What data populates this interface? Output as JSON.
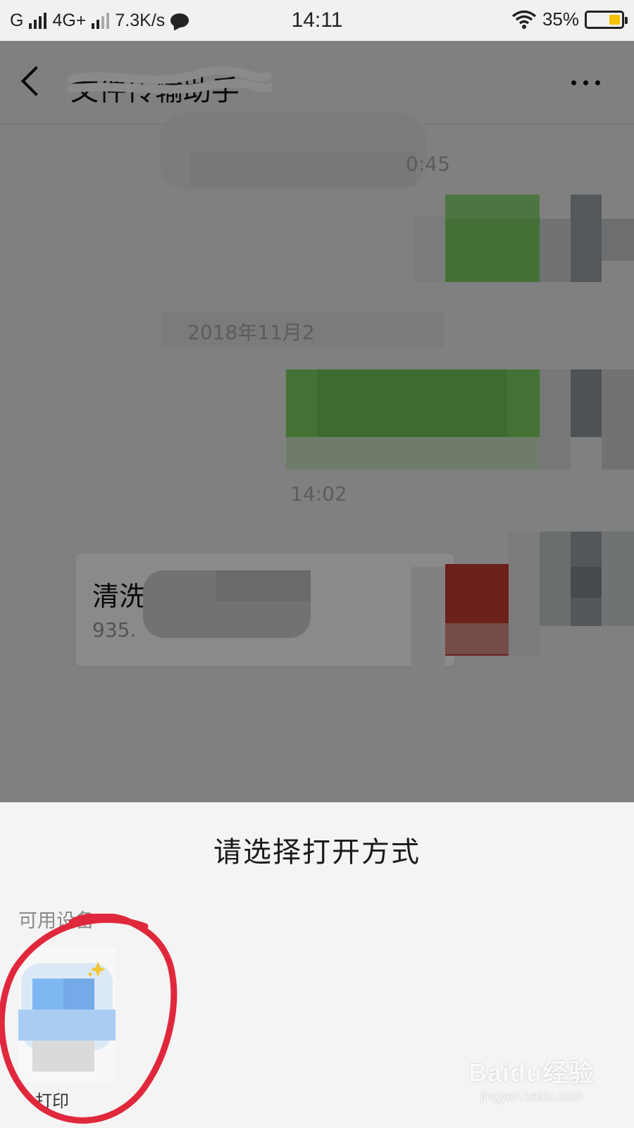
{
  "status_bar": {
    "carrier1": "G",
    "network": "4G+",
    "speed": "7.3K/s",
    "time": "14:11",
    "battery": "35%",
    "battery_level": 0.35,
    "battery_color": "#f2c200"
  },
  "chat": {
    "title": "文件传输助手",
    "timestamps": [
      "0:45",
      "2018年11月2",
      "14:02"
    ],
    "file_card": {
      "name": "清洗",
      "size": "935."
    },
    "icons": {
      "back": "back-chevron-icon",
      "more": "more-dots-icon"
    }
  },
  "sheet": {
    "title": "请选择打开方式",
    "section_label": "可用设备",
    "device": {
      "label": "打印"
    }
  },
  "watermark": {
    "logo": "Baidu经验",
    "url": "jingyan.baidu.com"
  },
  "colors": {
    "annotation": "#e0283c",
    "bubble_green": "#7ee266",
    "file_red": "#d33a32"
  }
}
